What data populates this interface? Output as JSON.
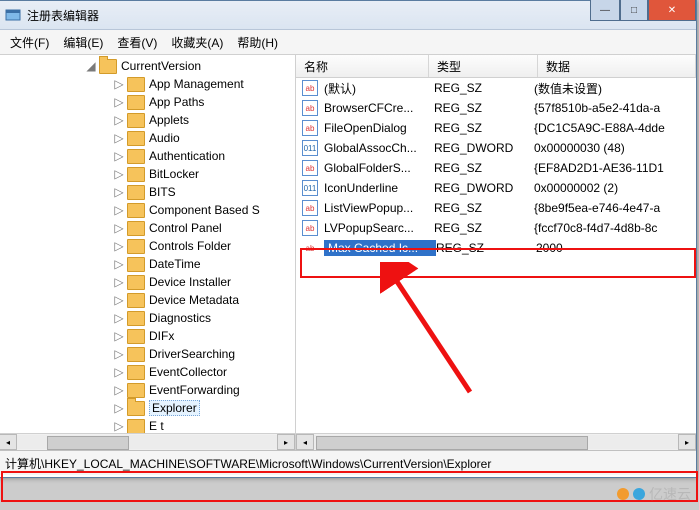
{
  "window": {
    "title": "注册表编辑器"
  },
  "win_buttons": {
    "min": "—",
    "max": "□",
    "close": "✕"
  },
  "menu": [
    "文件(F)",
    "编辑(E)",
    "查看(V)",
    "收藏夹(A)",
    "帮助(H)"
  ],
  "tree": {
    "parent": "CurrentVersion",
    "children": [
      "App Management",
      "App Paths",
      "Applets",
      "Audio",
      "Authentication",
      "BitLocker",
      "BITS",
      "Component Based S",
      "Control Panel",
      "Controls Folder",
      "DateTime",
      "Device Installer",
      "Device Metadata",
      "Diagnostics",
      "DIFx",
      "DriverSearching",
      "EventCollector",
      "EventForwarding",
      "Explorer",
      "E t"
    ],
    "selected": "Explorer"
  },
  "list": {
    "headers": {
      "name": "名称",
      "type": "类型",
      "data": "数据"
    },
    "rows": [
      {
        "icon": "str",
        "name": "(默认)",
        "type": "REG_SZ",
        "data": "(数值未设置)"
      },
      {
        "icon": "str",
        "name": "BrowserCFCre...",
        "type": "REG_SZ",
        "data": "{57f8510b-a5e2-41da-a"
      },
      {
        "icon": "str",
        "name": "FileOpenDialog",
        "type": "REG_SZ",
        "data": "{DC1C5A9C-E88A-4dde"
      },
      {
        "icon": "bin",
        "name": "GlobalAssocCh...",
        "type": "REG_DWORD",
        "data": "0x00000030 (48)"
      },
      {
        "icon": "str",
        "name": "GlobalFolderS...",
        "type": "REG_SZ",
        "data": "{EF8AD2D1-AE36-11D1"
      },
      {
        "icon": "bin",
        "name": "IconUnderline",
        "type": "REG_DWORD",
        "data": "0x00000002 (2)"
      },
      {
        "icon": "str",
        "name": "ListViewPopup...",
        "type": "REG_SZ",
        "data": "{8be9f5ea-e746-4e47-a"
      },
      {
        "icon": "str",
        "name": "LVPopupSearc...",
        "type": "REG_SZ",
        "data": "{fccf70c8-f4d7-4d8b-8c"
      },
      {
        "icon": "str",
        "name": "Max Cached Ic...",
        "type": "REG_SZ",
        "data": "2000",
        "selected": true
      }
    ]
  },
  "status": "计算机\\HKEY_LOCAL_MACHINE\\SOFTWARE\\Microsoft\\Windows\\CurrentVersion\\Explorer",
  "watermark": "亿速云"
}
